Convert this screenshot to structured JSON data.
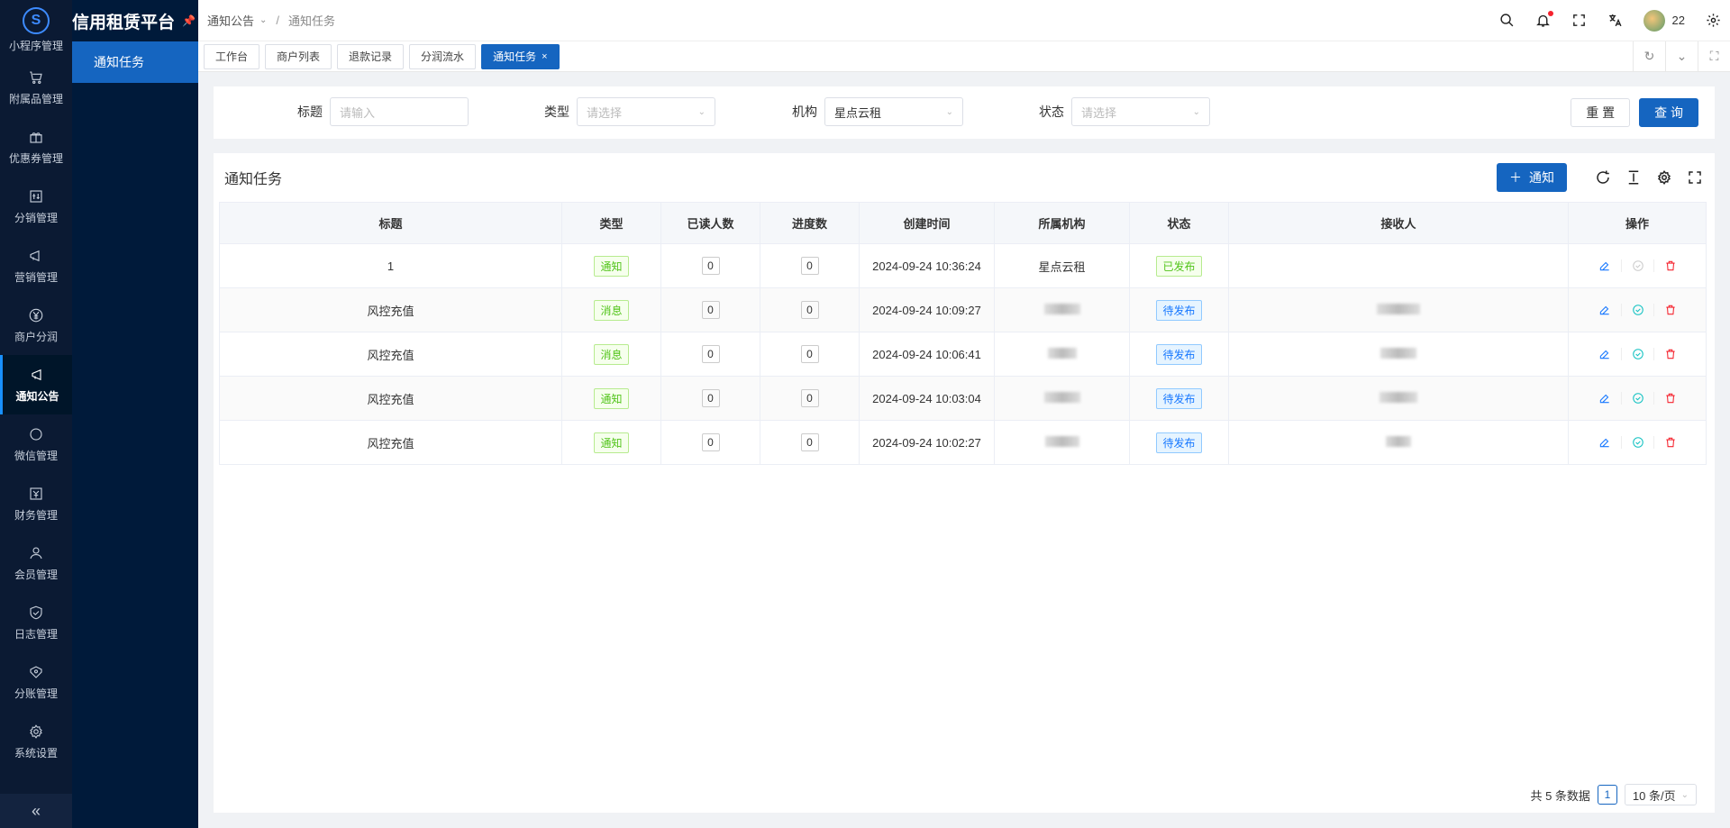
{
  "app": {
    "title": "信用租赁平台"
  },
  "rail": {
    "first_label": "小程序管理",
    "items": [
      {
        "label": "附属品管理",
        "icon": "cart-icon"
      },
      {
        "label": "优惠券管理",
        "icon": "gift-icon"
      },
      {
        "label": "分销管理",
        "icon": "distribution-icon"
      },
      {
        "label": "营销管理",
        "icon": "megaphone-icon"
      },
      {
        "label": "商户分润",
        "icon": "yen-icon"
      },
      {
        "label": "通知公告",
        "icon": "notice-icon"
      },
      {
        "label": "微信管理",
        "icon": "wechat-icon"
      },
      {
        "label": "财务管理",
        "icon": "finance-icon"
      },
      {
        "label": "会员管理",
        "icon": "member-icon"
      },
      {
        "label": "日志管理",
        "icon": "shield-icon"
      },
      {
        "label": "分账管理",
        "icon": "split-icon"
      },
      {
        "label": "系统设置",
        "icon": "gear-icon"
      }
    ],
    "active_index": 5,
    "collapse_glyph": "«"
  },
  "submenu": {
    "items": [
      {
        "label": "通知任务"
      }
    ]
  },
  "header": {
    "breadcrumb": [
      "通知公告",
      "通知任务"
    ],
    "user_name": "22"
  },
  "tabs": [
    {
      "label": "工作台"
    },
    {
      "label": "商户列表"
    },
    {
      "label": "退款记录"
    },
    {
      "label": "分润流水"
    },
    {
      "label": "通知任务",
      "active": true,
      "close": "×"
    }
  ],
  "search": {
    "title_label": "标题",
    "title_placeholder": "请输入",
    "type_label": "类型",
    "type_placeholder": "请选择",
    "org_label": "机构",
    "org_value": "星点云租",
    "status_label": "状态",
    "status_placeholder": "请选择",
    "reset_label": "重 置",
    "query_label": "查 询"
  },
  "card": {
    "title": "通知任务",
    "add_label": "通知",
    "add_glyph": "＋"
  },
  "table": {
    "columns": [
      "标题",
      "类型",
      "已读人数",
      "进度数",
      "创建时间",
      "所属机构",
      "状态",
      "接收人",
      "操作"
    ],
    "rows": [
      {
        "title": "1",
        "type": "通知",
        "read": "0",
        "progress": "0",
        "created": "2024-09-24 10:36:24",
        "org": "星点云租",
        "status": "已发布",
        "status_color": "green",
        "receiver": ""
      },
      {
        "title": "风控充值",
        "type": "消息",
        "read": "0",
        "progress": "0",
        "created": "2024-09-24 10:09:27",
        "org": "",
        "status": "待发布",
        "status_color": "blue",
        "receiver": ""
      },
      {
        "title": "风控充值",
        "type": "消息",
        "read": "0",
        "progress": "0",
        "created": "2024-09-24 10:06:41",
        "org": "",
        "status": "待发布",
        "status_color": "blue",
        "receiver": ""
      },
      {
        "title": "风控充值",
        "type": "通知",
        "read": "0",
        "progress": "0",
        "created": "2024-09-24 10:03:04",
        "org": "",
        "status": "待发布",
        "status_color": "blue",
        "receiver": ""
      },
      {
        "title": "风控充值",
        "type": "通知",
        "read": "0",
        "progress": "0",
        "created": "2024-09-24 10:02:27",
        "org": "",
        "status": "待发布",
        "status_color": "blue",
        "receiver": ""
      }
    ]
  },
  "pagination": {
    "total_text": "共 5 条数据",
    "current_page": "1",
    "page_size": "10 条/页"
  },
  "colors": {
    "primary": "#1565c0",
    "sidebar": "#0b1a33",
    "success": "#52c41a",
    "info": "#1677ff",
    "danger": "#f5222d"
  }
}
